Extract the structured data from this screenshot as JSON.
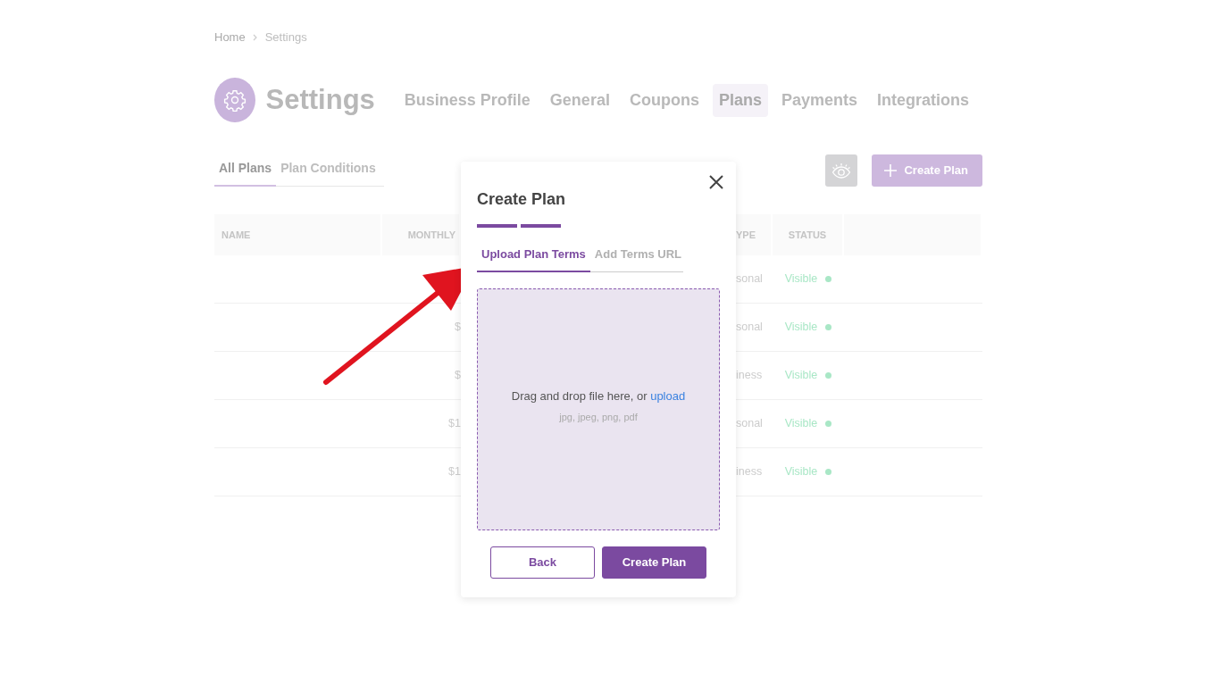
{
  "breadcrumb": [
    "Home",
    "Settings"
  ],
  "page_title": "Settings",
  "nav_tabs": [
    {
      "label": "Business Profile",
      "selected": false
    },
    {
      "label": "General",
      "selected": false
    },
    {
      "label": "Coupons",
      "selected": false
    },
    {
      "label": "Plans",
      "selected": true
    },
    {
      "label": "Payments",
      "selected": false
    },
    {
      "label": "Integrations",
      "selected": false
    }
  ],
  "sub_tabs": [
    {
      "label": "All Plans",
      "selected": true
    },
    {
      "label": "Plan Conditions",
      "selected": false
    }
  ],
  "toolbar": {
    "create_button": "Create Plan"
  },
  "table": {
    "columns": [
      "NAME",
      "MONTHLY",
      "YPE",
      "STATUS"
    ],
    "rows": [
      {
        "type": "sonal",
        "status": "Visible"
      },
      {
        "monthly": "$",
        "type": "sonal",
        "status": "Visible"
      },
      {
        "monthly": "$",
        "type": "iness",
        "status": "Visible"
      },
      {
        "monthly": "$1",
        "type": "sonal",
        "status": "Visible"
      },
      {
        "monthly": "$1",
        "type": "iness",
        "status": "Visible"
      }
    ]
  },
  "modal": {
    "title": "Create Plan",
    "steps": [
      {
        "done": true
      },
      {
        "done": true
      }
    ],
    "tabs": [
      {
        "label": "Upload Plan Terms",
        "selected": true
      },
      {
        "label": "Add Terms URL",
        "selected": false
      }
    ],
    "dropzone": {
      "text": "Drag and drop file here, or",
      "link": "upload",
      "hint": "jpg, jpeg, png, pdf"
    },
    "buttons": [
      {
        "label": "Back",
        "kind": "outline"
      },
      {
        "label": "Create Plan",
        "kind": "primary"
      }
    ]
  }
}
